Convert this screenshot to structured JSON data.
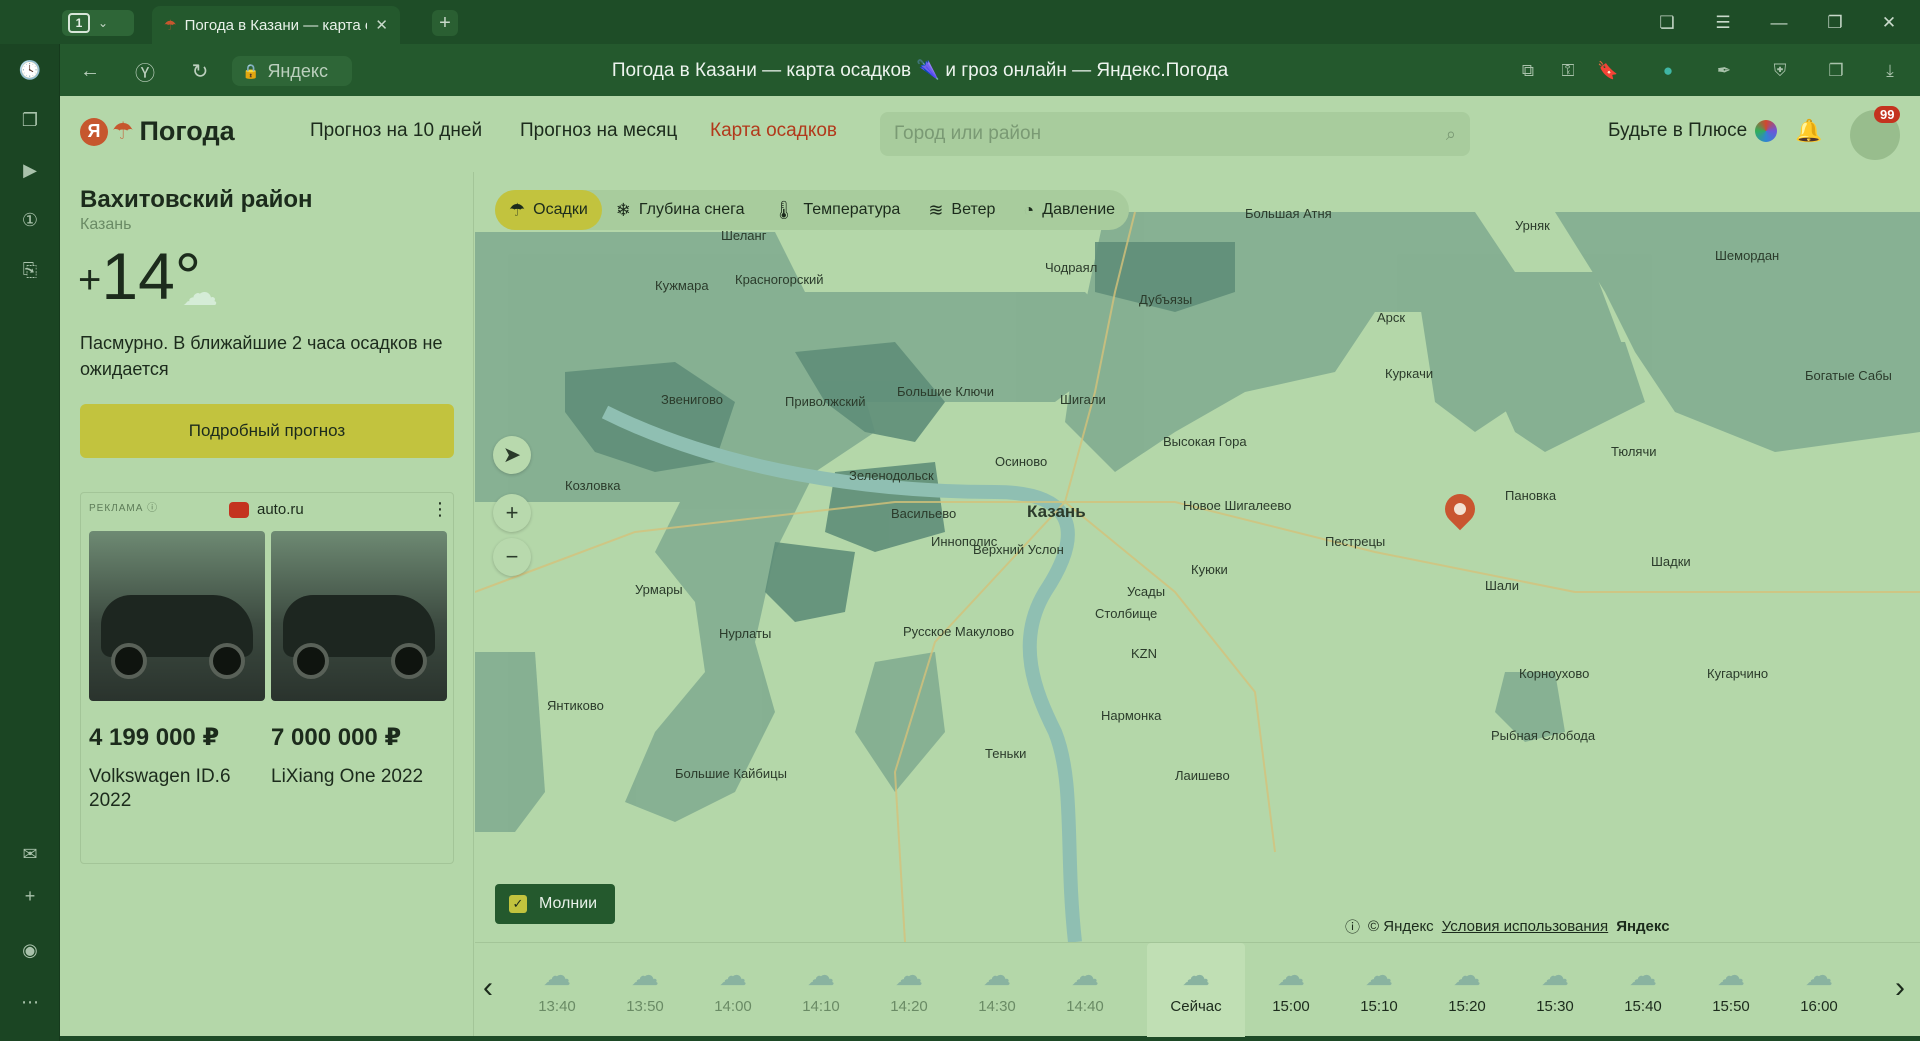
{
  "browser": {
    "tab_count": "1",
    "tab_title": "Погода в Казани — карта осадков и грозы онлайн",
    "url_host": "Яндекс",
    "page_title": "Погода в Казани — карта осадков 🌂 и гроз онлайн — Яндекс.Погода"
  },
  "header": {
    "logo_letter": "Я",
    "logo_text": "Погода",
    "nav": [
      "Прогноз на 10 дней",
      "Прогноз на месяц",
      "Карта осадков"
    ],
    "search_placeholder": "Город или район",
    "plus_text": "Будьте в Плюсе",
    "badge": "99"
  },
  "weather": {
    "district": "Вахитовский район",
    "city": "Казань",
    "temp_sign": "+",
    "temp_value": "14°",
    "description": "Пасмурно. В ближайшие 2 часа осадков не ожидается",
    "detail_button": "Подробный прогноз"
  },
  "ad": {
    "label": "РЕКЛАМА",
    "source": "auto.ru",
    "items": [
      {
        "price": "4 199 000 ₽",
        "name": "Volkswagen ID.6 2022"
      },
      {
        "price": "7 000 000 ₽",
        "name": "LiXiang One 2022"
      }
    ]
  },
  "map": {
    "layers": [
      {
        "label": "Осадки",
        "icon": "rain-icon"
      },
      {
        "label": "Глубина снега",
        "icon": "snowflake-icon"
      },
      {
        "label": "Температура",
        "icon": "thermometer-icon"
      },
      {
        "label": "Ветер",
        "icon": "wind-icon"
      },
      {
        "label": "Давление",
        "icon": "gauge-icon"
      }
    ],
    "lightning_label": "Молнии",
    "copyright": "© Яндекс",
    "terms": "Условия использования",
    "brand": "Яндекс",
    "places": {
      "kazan": "Казань",
      "zelenodolsk": "Зеленодольск",
      "vasilyevo": "Васильево",
      "zvenigovo": "Звенигово",
      "shigaly": "Шигали",
      "vysokaya_gora": "Высокая Гора",
      "novoe_shigaleevo": "Новое Шигалеево",
      "pestretsy": "Пестрецы",
      "kuyuki": "Куюки",
      "osinovo": "Осиново",
      "verkhny_uslon": "Верхний Услон",
      "stolbishche": "Столбище",
      "usady": "Усады",
      "kzn": "KZN",
      "dubyazy": "Дубъязы",
      "arsk": "Арск",
      "kurkachi": "Куркачи",
      "urmary": "Урмары",
      "kozlovka": "Козловка",
      "nurlaty": "Нурлаты",
      "yantikovo": "Янтиково",
      "russkoe_makulovo": "Русское Макулово",
      "narmonka": "Нармонка",
      "teнki": "Теньки",
      "laishevo": "Лаишево",
      "bolshie_kaibitsy": "Большие Кайбицы",
      "krasnogorsky": "Красногорский",
      "kuzhmara": "Кужмара",
      "shelanger": "Шеланг",
      "urnyak": "Урняк",
      "shemordan": "Шемордан",
      "tyulyachi": "Тюлячи",
      "panovka": "Пановка",
      "shali": "Шали",
      "shadki": "Шадки",
      "kornoukhovo": "Корноухово",
      "kugarchino": "Кугарчино",
      "rybnaya_sloboda": "Рыбная Слобода",
      "bolshie_klyuchi": "Большие Ключи",
      "privolzhsky": "Приволжский",
      "innopolis": "Иннополис",
      "bolshaya_atnya": "Большая Атня",
      "chodrayal": "Чодраял",
      "bogatye_saby": "Богатые Сабы"
    }
  },
  "timeline": {
    "items": [
      "13:40",
      "13:50",
      "14:00",
      "14:10",
      "14:20",
      "14:30",
      "14:40",
      "Сейчас",
      "15:00",
      "15:10",
      "15:20",
      "15:30",
      "15:40",
      "15:50",
      "16:00"
    ],
    "now_index": 7
  }
}
